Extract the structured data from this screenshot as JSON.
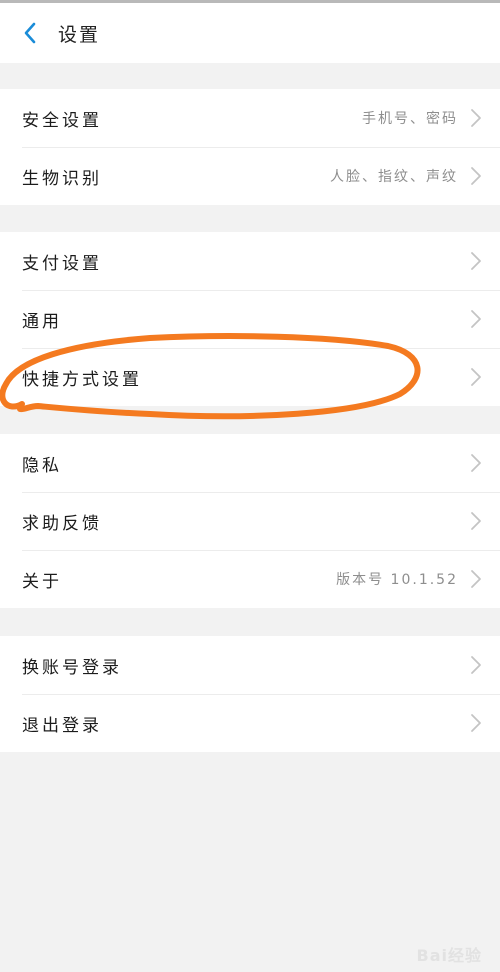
{
  "header": {
    "title": "设置",
    "back_icon": "chevron-left-icon",
    "accent": "#1a8cd8"
  },
  "groups": [
    {
      "items": [
        {
          "label": "安全设置",
          "value": "手机号、密码"
        },
        {
          "label": "生物识别",
          "value": "人脸、指纹、声纹"
        }
      ]
    },
    {
      "items": [
        {
          "label": "支付设置",
          "value": ""
        },
        {
          "label": "通用",
          "value": ""
        },
        {
          "label": "快捷方式设置",
          "value": ""
        }
      ]
    },
    {
      "items": [
        {
          "label": "隐私",
          "value": ""
        },
        {
          "label": "求助反馈",
          "value": ""
        },
        {
          "label": "关于",
          "value": "版本号 10.1.52"
        }
      ]
    },
    {
      "items": [
        {
          "label": "换账号登录",
          "value": ""
        },
        {
          "label": "退出登录",
          "value": ""
        }
      ]
    }
  ],
  "annotation": {
    "color": "#f47a20",
    "target": "快捷方式设置"
  },
  "watermark": "Bai经验"
}
